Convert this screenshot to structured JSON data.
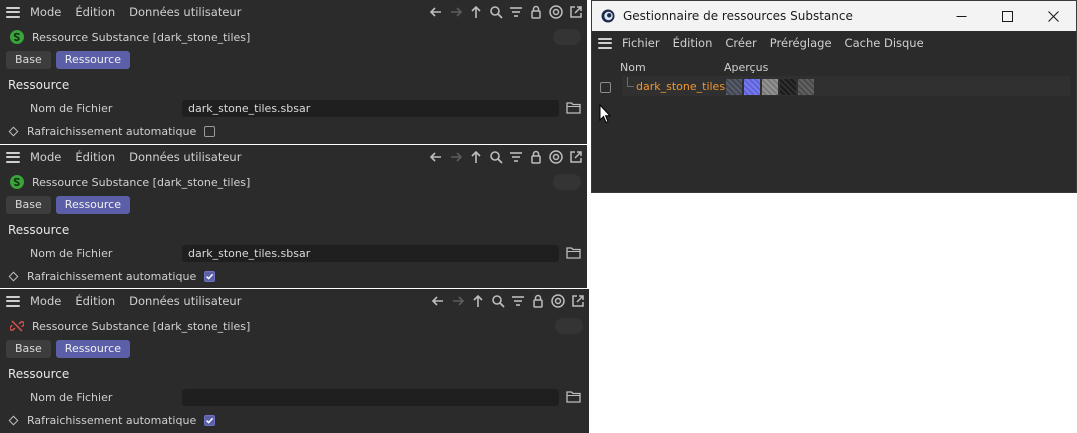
{
  "attr_panels": [
    {
      "menu": [
        "Mode",
        "Édition",
        "Données utilisateur"
      ],
      "title": "Ressource Substance [dark_stone_tiles]",
      "icon": "substance-s-icon",
      "icon_color": "#3aa33a",
      "tabs": [
        "Base",
        "Ressource"
      ],
      "active_tab": "Ressource",
      "section": "Ressource",
      "file_label": "Nom de Fichier",
      "file_value": "dark_stone_tiles.sbsar",
      "auto_label": "Rafraichissement automatique",
      "auto_checked": false
    },
    {
      "menu": [
        "Mode",
        "Édition",
        "Données utilisateur"
      ],
      "title": "Ressource Substance [dark_stone_tiles]",
      "icon": "substance-s-icon",
      "icon_color": "#3aa33a",
      "tabs": [
        "Base",
        "Ressource"
      ],
      "active_tab": "Ressource",
      "section": "Ressource",
      "file_label": "Nom de Fichier",
      "file_value": "dark_stone_tiles.sbsar",
      "auto_label": "Rafraichissement automatique",
      "auto_checked": true
    },
    {
      "menu": [
        "Mode",
        "Édition",
        "Données utilisateur"
      ],
      "title": "Ressource Substance [dark_stone_tiles]",
      "icon": "broken-link-icon",
      "icon_color": "#d9534f",
      "tabs": [
        "Base",
        "Ressource"
      ],
      "active_tab": "Ressource",
      "section": "Ressource",
      "file_label": "Nom de Fichier",
      "file_value": "",
      "auto_label": "Rafraichissement automatique",
      "auto_checked": true
    }
  ],
  "manager": {
    "title": "Gestionnaire de ressources Substance",
    "menu": [
      "Fichier",
      "Édition",
      "Créer",
      "Préréglage",
      "Cache Disque"
    ],
    "columns": {
      "name": "Nom",
      "previews": "Aperçus"
    },
    "rows": [
      {
        "name": "dark_stone_tiles",
        "name_color": "#f0972f",
        "preview_colors": [
          "#4a4f5c",
          "#6b6ff0",
          "#8a8a8a",
          "#1e1e1e",
          "#555555"
        ]
      }
    ]
  },
  "colors": {
    "panel_bg": "#2b2b2b",
    "accent": "#5a5fa8",
    "input_bg": "#1f1f1f"
  }
}
